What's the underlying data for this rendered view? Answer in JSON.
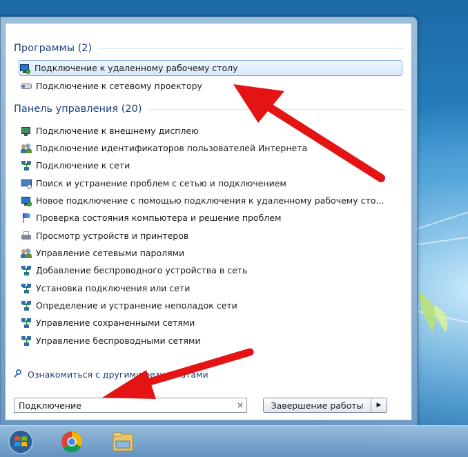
{
  "programs": {
    "header": "Программы (2)",
    "items": [
      {
        "label": "Подключение к удаленному рабочему столу",
        "icon": "remote-desktop-icon",
        "selected": true
      },
      {
        "label": "Подключение к сетевому проектору",
        "icon": "network-projector-icon"
      }
    ]
  },
  "control_panel": {
    "header": "Панель управления (20)",
    "items": [
      {
        "label": "Подключение к внешнему дисплею",
        "icon": "display-icon"
      },
      {
        "label": "Подключение идентификаторов пользователей Интернета",
        "icon": "users-icon"
      },
      {
        "label": "Подключение к сети",
        "icon": "network-icon"
      },
      {
        "label": "Поиск и устранение проблем с сетью и подключением",
        "icon": "troubleshoot-icon"
      },
      {
        "label": "Новое подключение с помощью подключения к удаленному рабочему сто...",
        "icon": "remote-desktop-icon"
      },
      {
        "label": "Проверка состояния компьютера и решение проблем",
        "icon": "action-center-flag-icon"
      },
      {
        "label": "Просмотр устройств и принтеров",
        "icon": "printer-icon"
      },
      {
        "label": "Управление сетевыми паролями",
        "icon": "users-icon"
      },
      {
        "label": "Добавление беспроводного устройства в сеть",
        "icon": "network-icon"
      },
      {
        "label": "Установка подключения или сети",
        "icon": "network-icon"
      },
      {
        "label": "Определение и устранение неполадок сети",
        "icon": "network-icon"
      },
      {
        "label": "Управление сохраненными сетями",
        "icon": "network-icon"
      },
      {
        "label": "Управление беспроводными сетями",
        "icon": "network-icon"
      }
    ]
  },
  "more_results": {
    "label": "Ознакомиться с другими результатами",
    "icon": "search-icon"
  },
  "search": {
    "value": "Подключение",
    "clear": "×"
  },
  "shutdown": {
    "label": "Завершение работы",
    "arrow": "▶"
  },
  "taskbar": {
    "items": [
      "start-orb-icon",
      "chrome-icon",
      "explorer-folder-icon"
    ]
  },
  "colors": {
    "accent": "#1e3f7a",
    "annotation_arrow": "#e41414",
    "selection_border": "#84acdd"
  }
}
